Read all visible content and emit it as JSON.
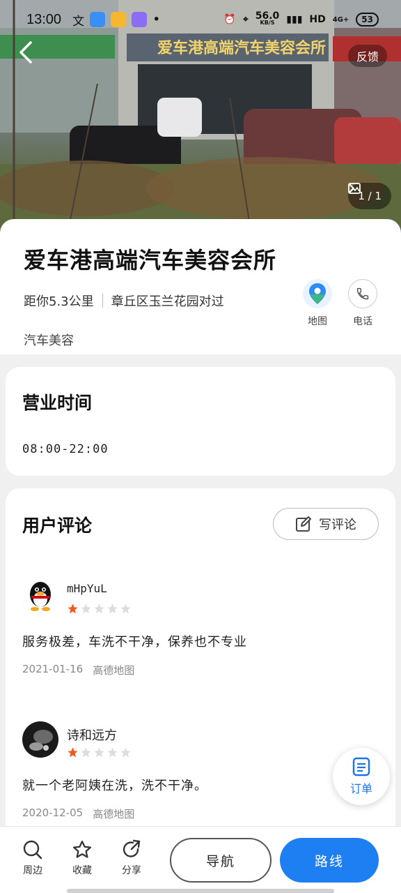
{
  "status_bar": {
    "time": "13:00",
    "network_speed": "56.0",
    "network_unit": "KB/S",
    "hd_label": "HD",
    "signal_label": "4G+",
    "battery": "53"
  },
  "hero": {
    "storefront_sign": "爱车港高端汽车美容会所",
    "feedback_label": "反馈",
    "photo_counter": "1 / 1"
  },
  "place": {
    "name": "爱车港高端汽车美容会所",
    "distance": "距你5.3公里",
    "address": "章丘区玉兰花园对过",
    "category": "汽车美容",
    "map_label": "地图",
    "phone_label": "电话"
  },
  "hours": {
    "title": "营业时间",
    "value": "08:00-22:00"
  },
  "reviews": {
    "title": "用户评论",
    "write_label": "写评论",
    "items": [
      {
        "name": "mHpYuL",
        "rating": 1,
        "max_rating": 5,
        "text": "服务极差，车洗不干净，保养也不专业",
        "date": "2021-01-16",
        "source": "高德地图"
      },
      {
        "name": "诗和远方",
        "rating": 1,
        "max_rating": 5,
        "text": "就一个老阿姨在洗，洗不干净。",
        "date": "2020-12-05",
        "source": "高德地图"
      }
    ]
  },
  "order_fab": {
    "label": "订单"
  },
  "bottom_bar": {
    "nearby": "周边",
    "favorite": "收藏",
    "share": "分享",
    "navigate": "导航",
    "route": "路线"
  },
  "colors": {
    "accent_blue": "#1e7ff2",
    "star_active": "#f25a1d",
    "star_inactive": "#dddddd"
  }
}
